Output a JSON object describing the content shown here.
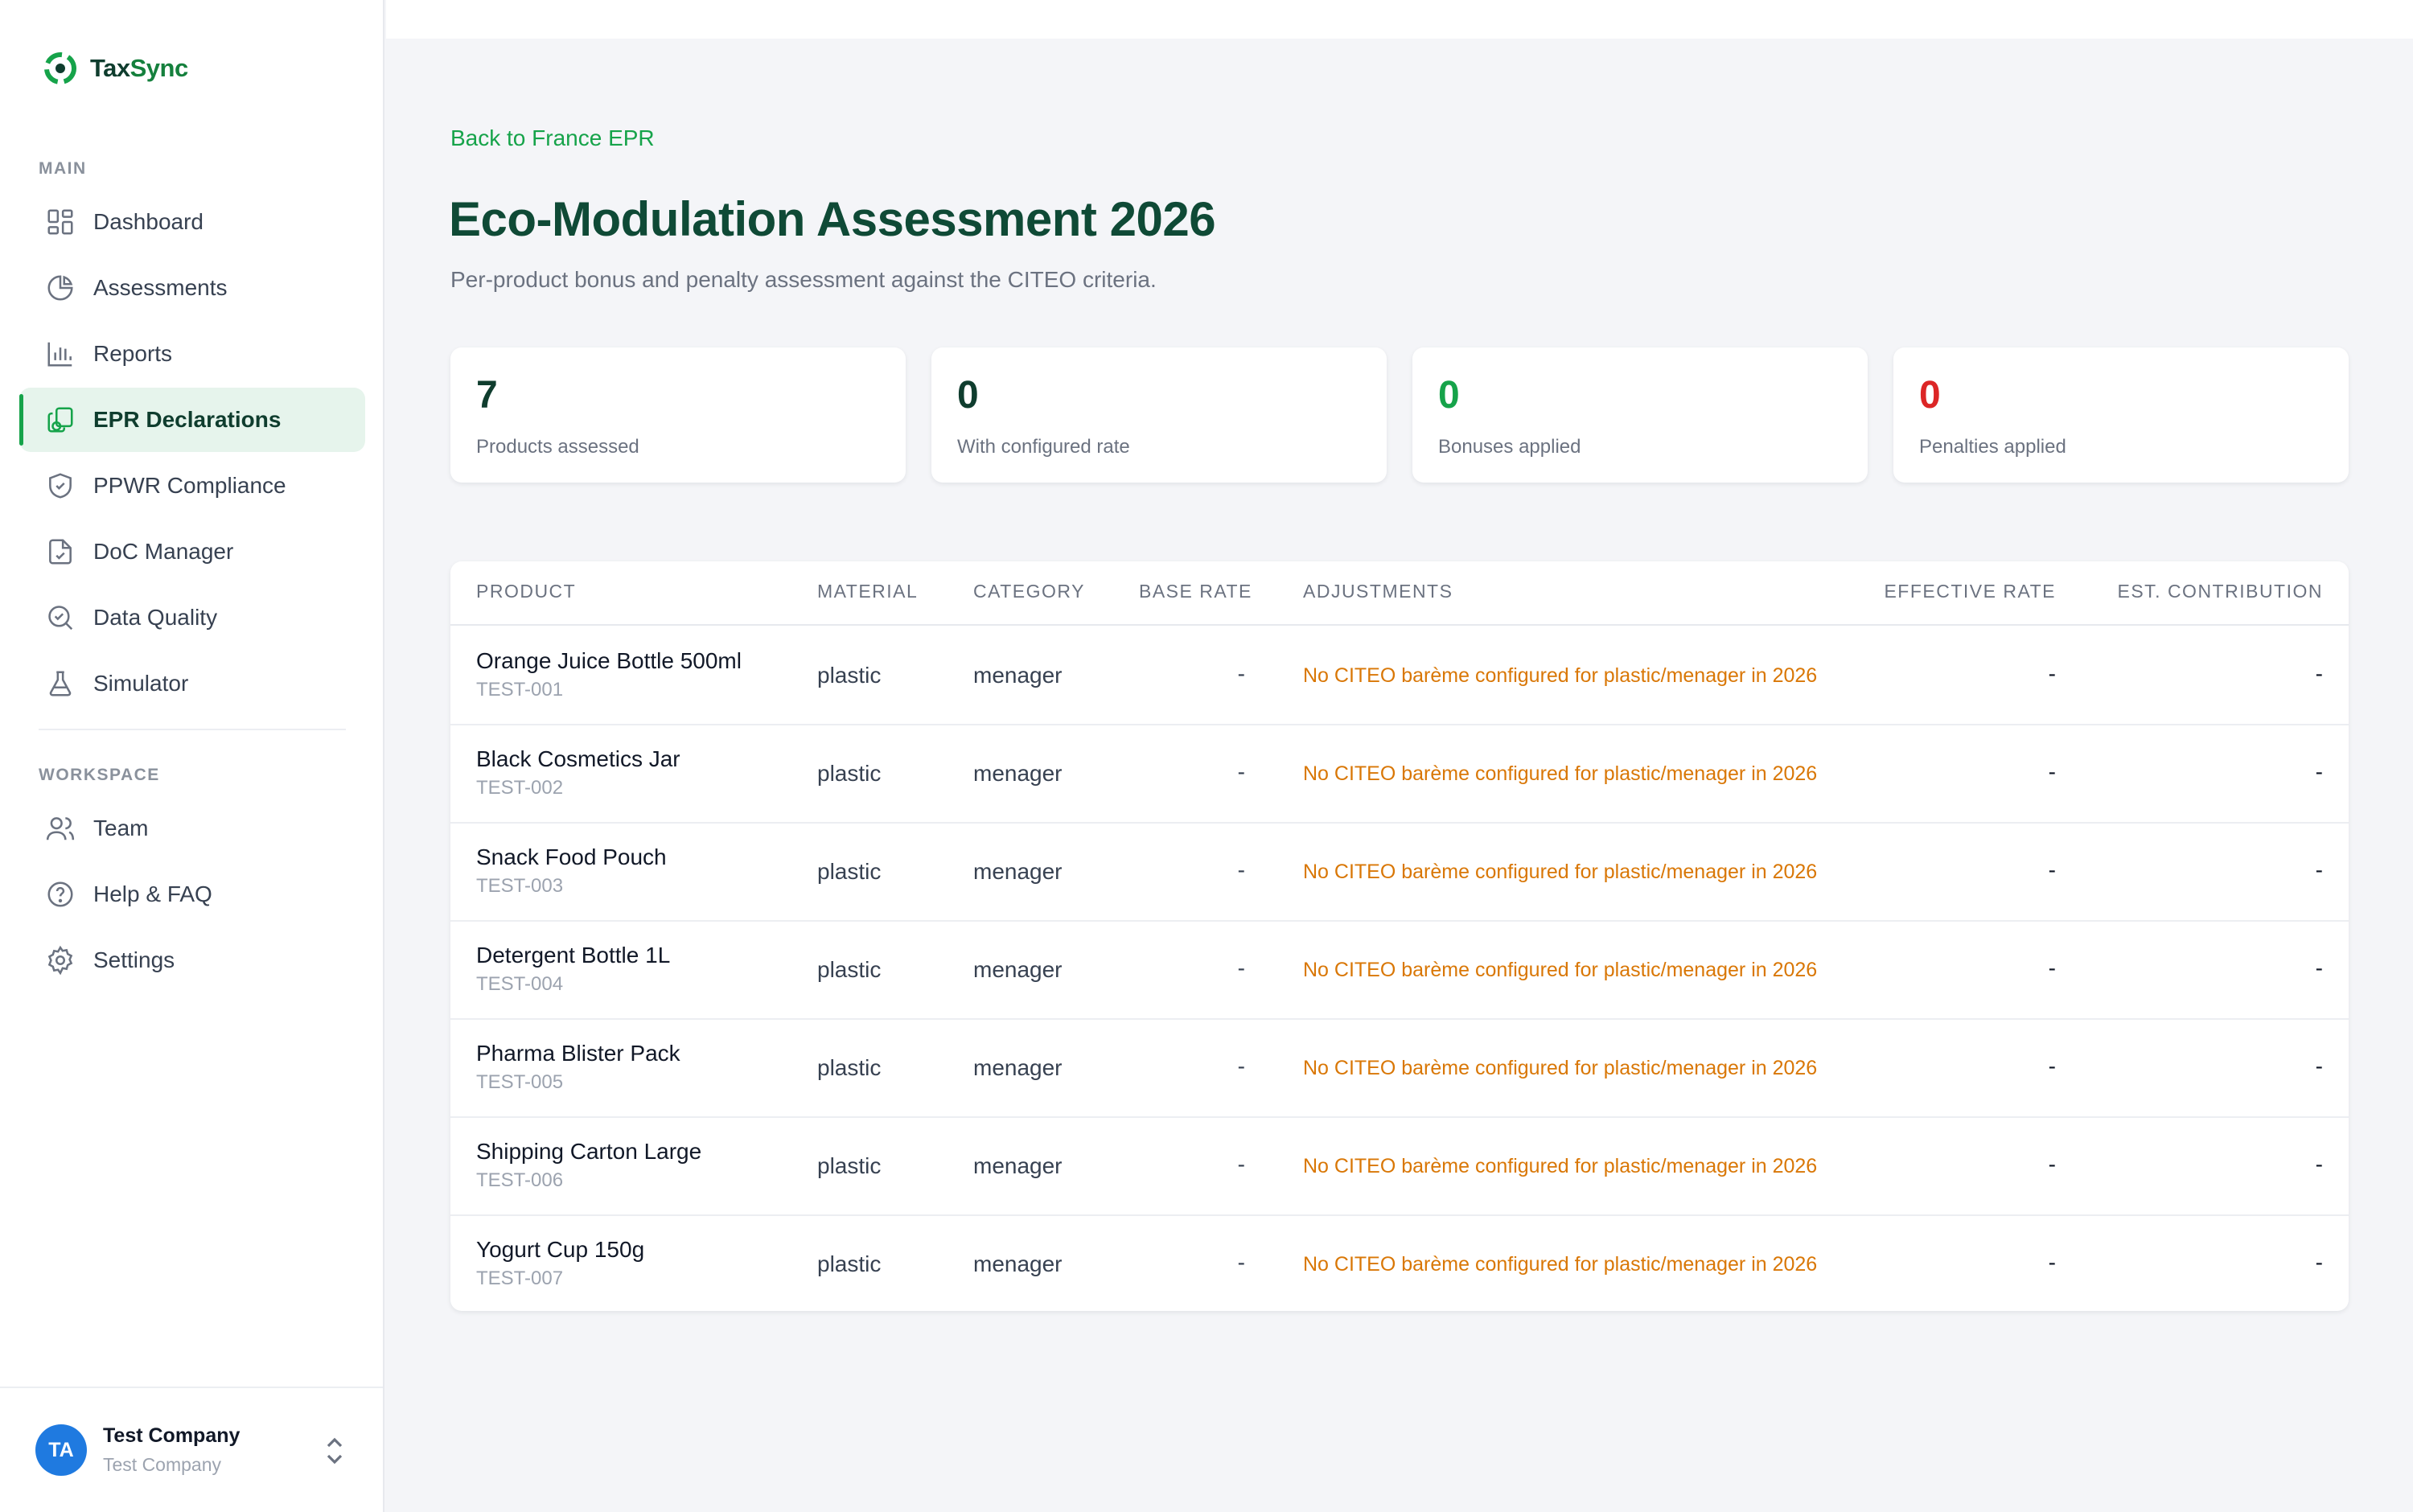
{
  "brand": {
    "part1": "Tax",
    "part2": "Sync"
  },
  "sidebar": {
    "main_label": "MAIN",
    "workspace_label": "WORKSPACE",
    "main_items": [
      {
        "label": "Dashboard",
        "icon": "grid-icon"
      },
      {
        "label": "Assessments",
        "icon": "pie-chart-icon"
      },
      {
        "label": "Reports",
        "icon": "bar-chart-icon"
      },
      {
        "label": "EPR Declarations",
        "icon": "documents-icon",
        "active": true
      },
      {
        "label": "PPWR Compliance",
        "icon": "shield-check-icon"
      },
      {
        "label": "DoC Manager",
        "icon": "file-check-icon"
      },
      {
        "label": "Data Quality",
        "icon": "search-check-icon"
      },
      {
        "label": "Simulator",
        "icon": "flask-icon"
      }
    ],
    "workspace_items": [
      {
        "label": "Team",
        "icon": "users-icon"
      },
      {
        "label": "Help & FAQ",
        "icon": "help-circle-icon"
      },
      {
        "label": "Settings",
        "icon": "gear-icon"
      }
    ],
    "user": {
      "initials": "TA",
      "name": "Test Company",
      "org": "Test Company"
    }
  },
  "header": {
    "back_link": "Back to France EPR",
    "title": "Eco-Modulation Assessment 2026",
    "subtitle": "Per-product bonus and penalty assessment against the CITEO criteria."
  },
  "stats": [
    {
      "value": "7",
      "label": "Products assessed",
      "color": "#0f3d2e"
    },
    {
      "value": "0",
      "label": "With configured rate",
      "color": "#0f3d2e"
    },
    {
      "value": "0",
      "label": "Bonuses applied",
      "color": "#16a34a"
    },
    {
      "value": "0",
      "label": "Penalties applied",
      "color": "#dc2626"
    }
  ],
  "table": {
    "columns": {
      "product": "PRODUCT",
      "material": "MATERIAL",
      "category": "CATEGORY",
      "base_rate": "BASE RATE",
      "adjustments": "ADJUSTMENTS",
      "effective_rate": "EFFECTIVE RATE",
      "est_contribution": "EST. CONTRIBUTION"
    },
    "rows": [
      {
        "name": "Orange Juice Bottle 500ml",
        "sku": "TEST-001",
        "material": "plastic",
        "category": "menager",
        "base_rate": "-",
        "adjustments": "No CITEO barème configured for plastic/menager in 2026",
        "effective_rate": "-",
        "est_contribution": "-"
      },
      {
        "name": "Black Cosmetics Jar",
        "sku": "TEST-002",
        "material": "plastic",
        "category": "menager",
        "base_rate": "-",
        "adjustments": "No CITEO barème configured for plastic/menager in 2026",
        "effective_rate": "-",
        "est_contribution": "-"
      },
      {
        "name": "Snack Food Pouch",
        "sku": "TEST-003",
        "material": "plastic",
        "category": "menager",
        "base_rate": "-",
        "adjustments": "No CITEO barème configured for plastic/menager in 2026",
        "effective_rate": "-",
        "est_contribution": "-"
      },
      {
        "name": "Detergent Bottle 1L",
        "sku": "TEST-004",
        "material": "plastic",
        "category": "menager",
        "base_rate": "-",
        "adjustments": "No CITEO barème configured for plastic/menager in 2026",
        "effective_rate": "-",
        "est_contribution": "-"
      },
      {
        "name": "Pharma Blister Pack",
        "sku": "TEST-005",
        "material": "plastic",
        "category": "menager",
        "base_rate": "-",
        "adjustments": "No CITEO barème configured for plastic/menager in 2026",
        "effective_rate": "-",
        "est_contribution": "-"
      },
      {
        "name": "Shipping Carton Large",
        "sku": "TEST-006",
        "material": "plastic",
        "category": "menager",
        "base_rate": "-",
        "adjustments": "No CITEO barème configured for plastic/menager in 2026",
        "effective_rate": "-",
        "est_contribution": "-"
      },
      {
        "name": "Yogurt Cup 150g",
        "sku": "TEST-007",
        "material": "plastic",
        "category": "menager",
        "base_rate": "-",
        "adjustments": "No CITEO barème configured for plastic/menager in 2026",
        "effective_rate": "-",
        "est_contribution": "-"
      }
    ]
  }
}
